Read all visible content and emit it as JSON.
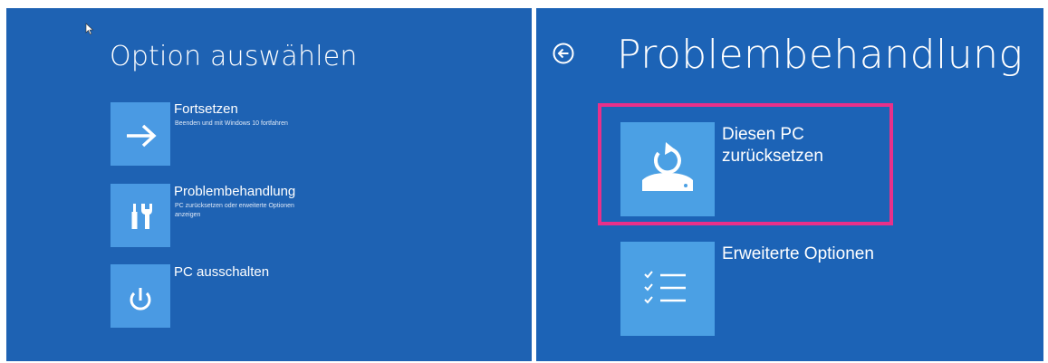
{
  "left_screen": {
    "title": "Option auswählen",
    "options": [
      {
        "label": "Fortsetzen",
        "description": "Beenden und mit Windows 10 fortfahren",
        "icon": "arrow-right-icon"
      },
      {
        "label": "Problembehandlung",
        "description": "PC zurücksetzen oder erweiterte Optionen anzeigen",
        "icon": "tools-icon"
      },
      {
        "label": "PC ausschalten",
        "description": "",
        "icon": "power-icon"
      }
    ]
  },
  "right_screen": {
    "title": "Problembehandlung",
    "back_icon": "back-arrow-icon",
    "options": [
      {
        "label": "Diesen PC zurücksetzen",
        "icon": "reset-pc-icon",
        "highlighted": true
      },
      {
        "label": "Erweiterte Optionen",
        "icon": "checklist-icon",
        "highlighted": false
      }
    ]
  },
  "colors": {
    "background": "#1e62b3",
    "tile": "#4a9ae3",
    "highlight": "#e8308a",
    "text": "#ffffff"
  }
}
